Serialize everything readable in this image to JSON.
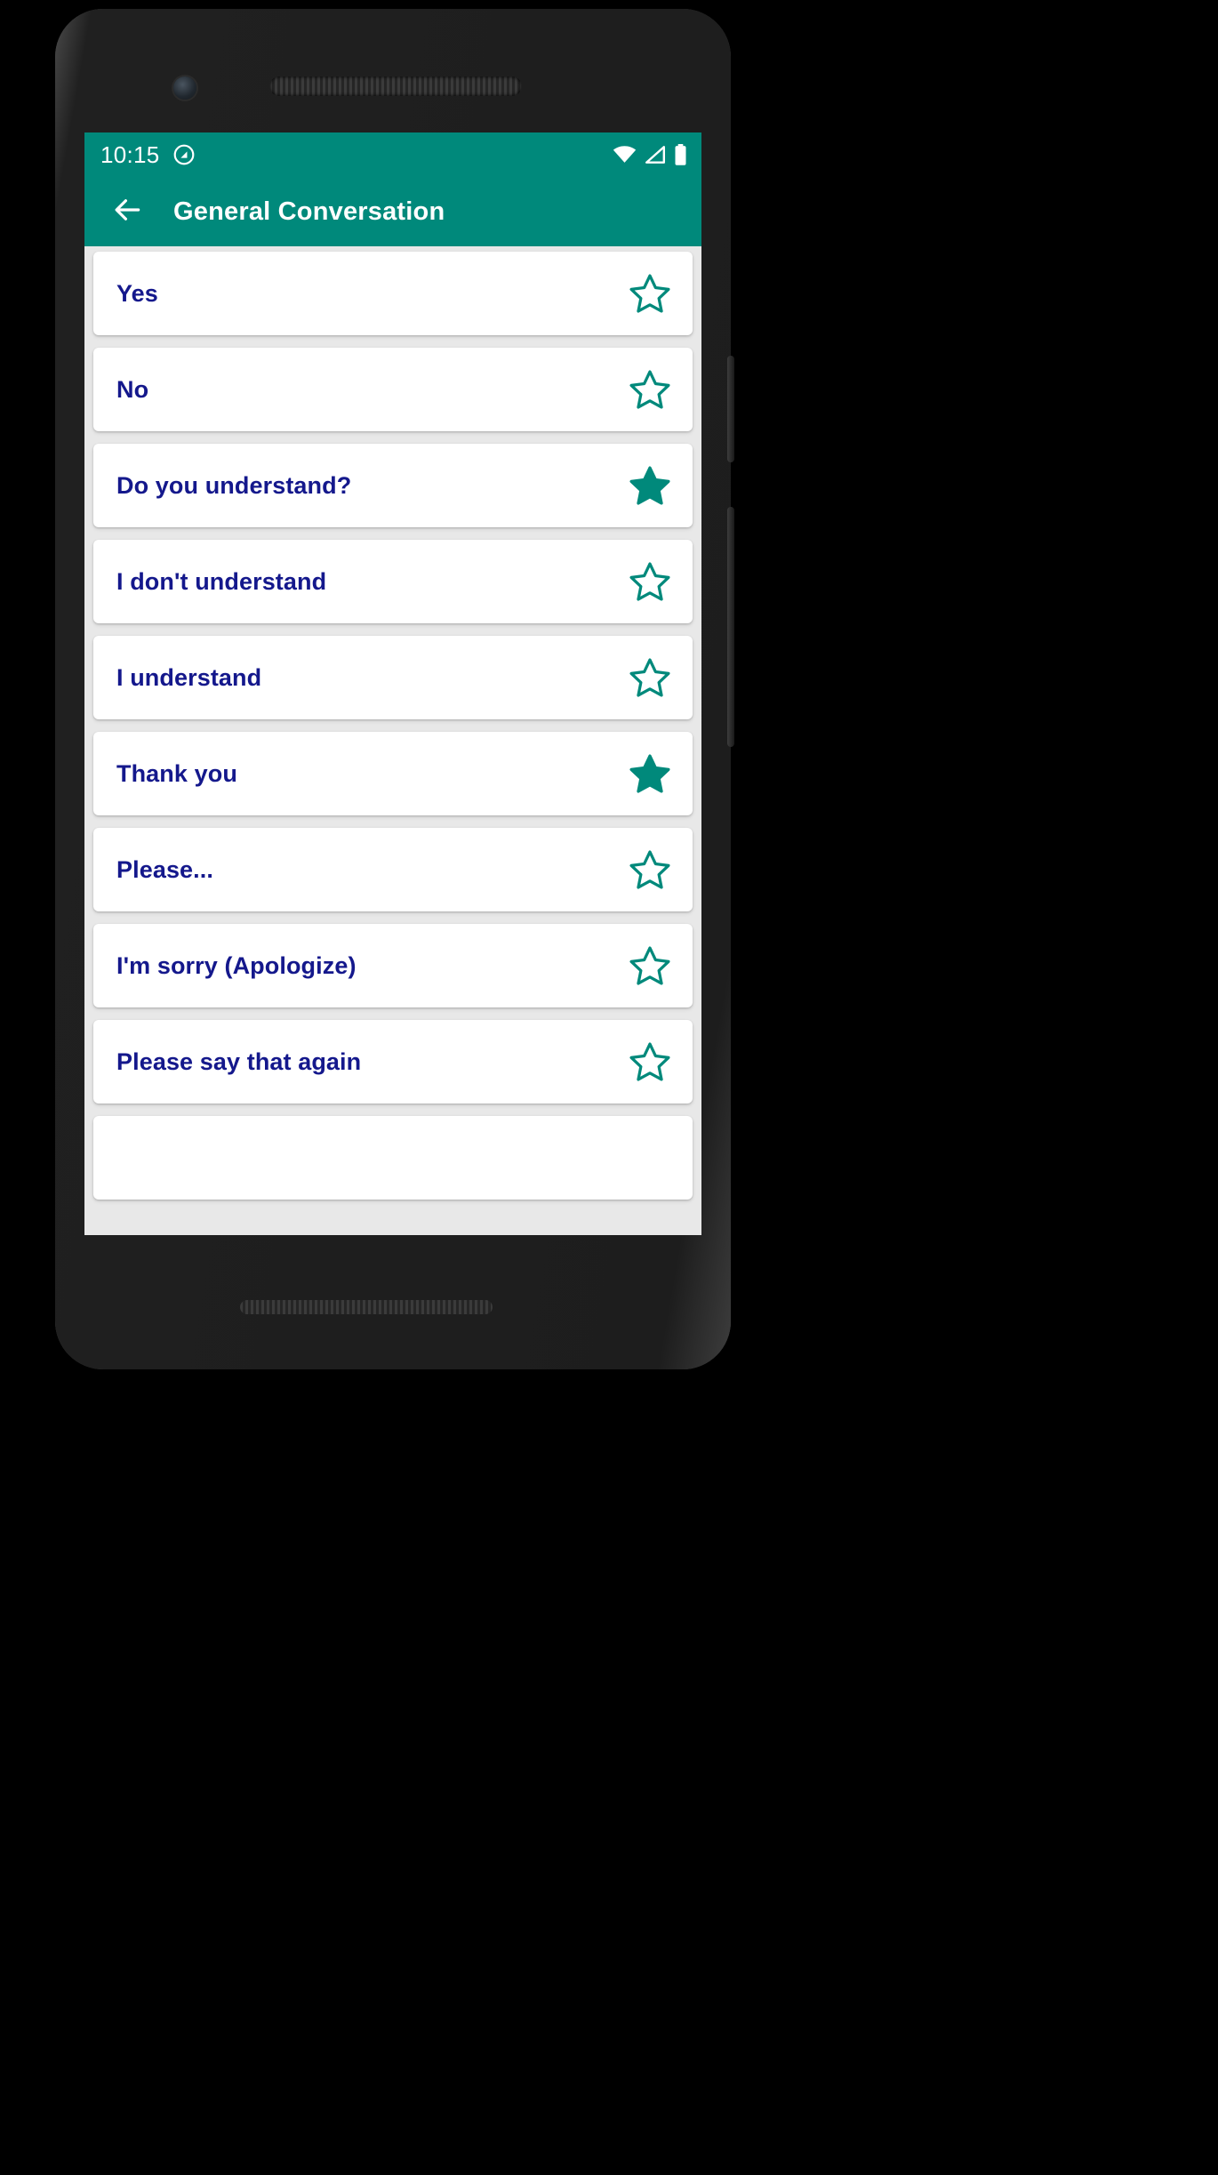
{
  "status_bar": {
    "time": "10:15",
    "icons": [
      "android-q-icon",
      "wifi-icon",
      "signal-icon",
      "battery-icon"
    ]
  },
  "app_bar": {
    "back_icon": "arrow-left-icon",
    "title": "General Conversation",
    "background_color": "#00897b",
    "text_color": "#ffffff"
  },
  "theme": {
    "accent": "#00897b",
    "label_color": "#14188c",
    "card_background": "#ffffff",
    "list_background": "#e8e8e8",
    "star_color": "#00897b"
  },
  "list": {
    "items": [
      {
        "label": "Yes",
        "favorite": false,
        "star_icon": "star-outline-icon"
      },
      {
        "label": "No",
        "favorite": false,
        "star_icon": "star-outline-icon"
      },
      {
        "label": "Do you understand?",
        "favorite": true,
        "star_icon": "star-filled-icon"
      },
      {
        "label": "I don't understand",
        "favorite": false,
        "star_icon": "star-outline-icon"
      },
      {
        "label": "I understand",
        "favorite": false,
        "star_icon": "star-outline-icon"
      },
      {
        "label": "Thank you",
        "favorite": true,
        "star_icon": "star-filled-icon"
      },
      {
        "label": "Please...",
        "favorite": false,
        "star_icon": "star-outline-icon"
      },
      {
        "label": "I'm sorry (Apologize)",
        "favorite": false,
        "star_icon": "star-outline-icon"
      },
      {
        "label": "Please say that again",
        "favorite": false,
        "star_icon": "star-outline-icon"
      }
    ]
  },
  "nav_bar": {
    "back_icon": "triangle-back-icon",
    "home_icon": "circle-home-icon",
    "recents_icon": "square-recents-icon"
  }
}
